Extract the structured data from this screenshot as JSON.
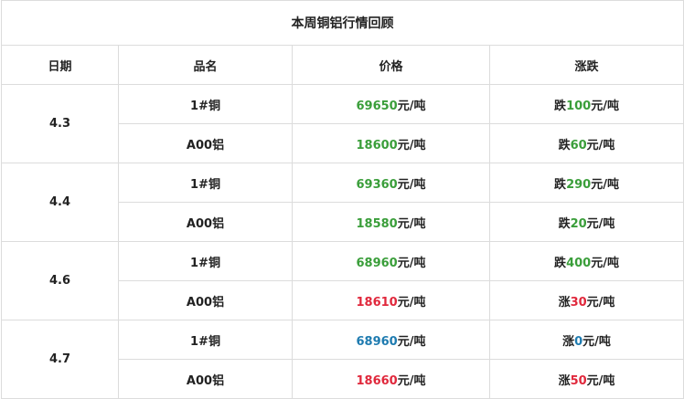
{
  "title": "本周铜铝行情回顾",
  "headers": {
    "date": "日期",
    "product": "品名",
    "price": "价格",
    "change": "涨跌"
  },
  "unit": "元/吨",
  "colors": {
    "green": "#3a9e3a",
    "red": "#e0283c",
    "blue": "#1e7bb0",
    "text": "#222222"
  },
  "groups": [
    {
      "date": "4.3",
      "rows": [
        {
          "product": "1#铜",
          "price": "69650",
          "price_color": "green",
          "change_word": "跌",
          "change_value": "100"
        },
        {
          "product": "A00铝",
          "price": "18600",
          "price_color": "green",
          "change_word": "跌",
          "change_value": "60"
        }
      ]
    },
    {
      "date": "4.4",
      "rows": [
        {
          "product": "1#铜",
          "price": "69360",
          "price_color": "green",
          "change_word": "跌",
          "change_value": "290"
        },
        {
          "product": "A00铝",
          "price": "18580",
          "price_color": "green",
          "change_word": "跌",
          "change_value": "20"
        }
      ]
    },
    {
      "date": "4.6",
      "rows": [
        {
          "product": "1#铜",
          "price": "68960",
          "price_color": "green",
          "change_word": "跌",
          "change_value": "400"
        },
        {
          "product": "A00铝",
          "price": "18610",
          "price_color": "red",
          "change_word": "涨",
          "change_value": "30"
        }
      ]
    },
    {
      "date": "4.7",
      "rows": [
        {
          "product": "1#铜",
          "price": "68960",
          "price_color": "blue",
          "change_word": "涨",
          "change_value": "0"
        },
        {
          "product": "A00铝",
          "price": "18660",
          "price_color": "red",
          "change_word": "涨",
          "change_value": "50"
        }
      ]
    }
  ]
}
